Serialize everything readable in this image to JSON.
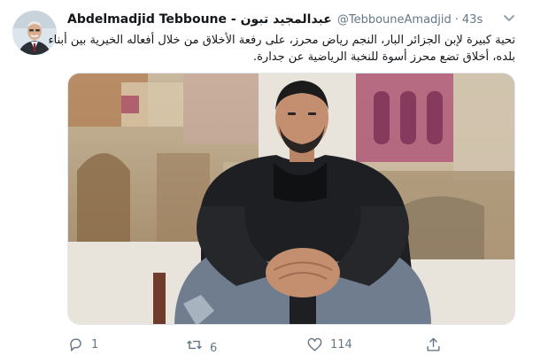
{
  "user": {
    "name": "Abdelmadjid Tebboune - عبدالمجيد تبون",
    "handle": "@TebbouneAmadjid",
    "separator": "·",
    "time": "43s"
  },
  "tweet": {
    "line1": "تحية كبيرة لإبن الجزائر البار، النجم رياض محرز، على رفعة الأخلاق من خلال أفعاله الخيرية بين أبناء",
    "line2": "بلده، أخلاق تضع محرز أسوة للنخبة الرياضية عن جدارة."
  },
  "actions": {
    "reply_count": "1",
    "retweet_count": "6",
    "like_count": "114"
  },
  "icons": {
    "chevron": "chevron-down-icon",
    "reply": "reply-icon",
    "retweet": "retweet-icon",
    "like": "heart-icon",
    "share": "share-icon"
  },
  "colors": {
    "text": "#14171a",
    "secondary": "#657786",
    "border": "#e1e8ed"
  }
}
